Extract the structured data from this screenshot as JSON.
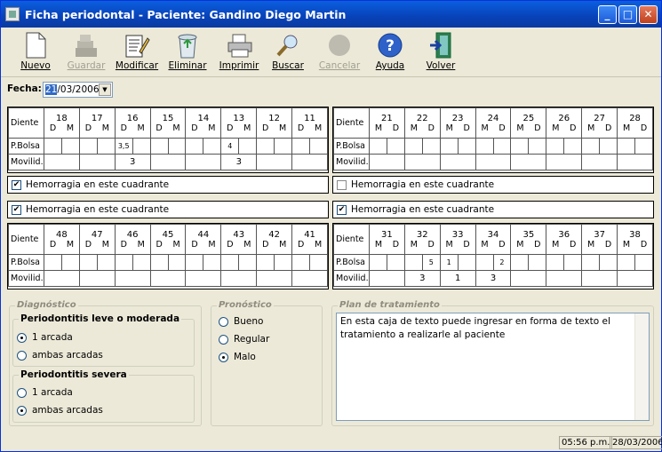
{
  "window": {
    "title": "Ficha periodontal - Paciente: Gandino Diego Martin"
  },
  "toolbar": [
    {
      "label": "Nuevo",
      "icon": "new-document-icon",
      "enabled": true
    },
    {
      "label": "Guardar",
      "icon": "save-icon",
      "enabled": false
    },
    {
      "label": "Modificar",
      "icon": "edit-document-icon",
      "enabled": true
    },
    {
      "label": "Eliminar",
      "icon": "recycle-bin-icon",
      "enabled": true
    },
    {
      "label": "Imprimir",
      "icon": "printer-icon",
      "enabled": true
    },
    {
      "label": "Buscar",
      "icon": "magnifier-icon",
      "enabled": true
    },
    {
      "label": "Cancelar",
      "icon": "cancel-icon",
      "enabled": false
    },
    {
      "label": "Ayuda",
      "icon": "help-icon",
      "enabled": true
    },
    {
      "label": "Volver",
      "icon": "exit-door-icon",
      "enabled": true
    }
  ],
  "fecha": {
    "label": "Fecha:",
    "value_sel": "21",
    "value_rest": "/03/2006"
  },
  "charts": {
    "q1": {
      "teeth": [
        "18",
        "17",
        "16",
        "15",
        "14",
        "13",
        "12",
        "11"
      ],
      "sides": [
        "D",
        "M"
      ],
      "pbolsa": [
        "",
        "",
        "",
        "",
        "3,5",
        "",
        "",
        "",
        "",
        "",
        "4",
        "",
        "",
        "",
        "",
        ""
      ],
      "movilid": [
        "",
        "",
        "3",
        "",
        "",
        "3",
        "",
        ""
      ],
      "hemorragia": true
    },
    "q2": {
      "teeth": [
        "21",
        "22",
        "23",
        "24",
        "25",
        "26",
        "27",
        "28"
      ],
      "sides": [
        "M",
        "D"
      ],
      "pbolsa": [
        "",
        "",
        "",
        "",
        "",
        "",
        "",
        "",
        "",
        "",
        "",
        "",
        "",
        "",
        "",
        ""
      ],
      "movilid": [
        "",
        "",
        "",
        "",
        "",
        "",
        "",
        ""
      ],
      "hemorragia": false
    },
    "q4": {
      "teeth": [
        "48",
        "47",
        "46",
        "45",
        "44",
        "43",
        "42",
        "41"
      ],
      "sides": [
        "D",
        "M"
      ],
      "pbolsa": [
        "",
        "",
        "",
        "",
        "",
        "",
        "",
        "",
        "",
        "",
        "",
        "",
        "",
        "",
        "",
        ""
      ],
      "movilid": [
        "",
        "",
        "",
        "",
        "",
        "",
        "",
        ""
      ],
      "hemorragia": true
    },
    "q3": {
      "teeth": [
        "31",
        "32",
        "33",
        "34",
        "35",
        "36",
        "37",
        "38"
      ],
      "sides": [
        "M",
        "D"
      ],
      "pbolsa": [
        "",
        "",
        "",
        "5",
        "1",
        "",
        "",
        "2",
        "",
        "",
        "",
        "",
        "",
        "",
        "",
        ""
      ],
      "movilid": [
        "",
        "3",
        "1",
        "3",
        "",
        "",
        "",
        ""
      ],
      "hemorragia": true
    }
  },
  "labels": {
    "diente": "Diente",
    "pbolsa": "P.Bolsa",
    "movilid": "Movilid.",
    "hemorragia": "Hemorragia en este cuadrante"
  },
  "diagnostico": {
    "title": "Diagnóstico",
    "leve": {
      "title": "Periodontitis leve o moderada",
      "options": [
        "1 arcada",
        "ambas arcadas"
      ],
      "selected": 0
    },
    "severa": {
      "title": "Periodontitis severa",
      "options": [
        "1 arcada",
        "ambas arcadas"
      ],
      "selected": 1
    }
  },
  "pronostico": {
    "title": "Pronóstico",
    "options": [
      "Bueno",
      "Regular",
      "Malo"
    ],
    "selected": 2
  },
  "plan": {
    "title": "Plan de tratamiento",
    "text": "En esta caja de texto puede ingresar en forma de texto el tratamiento a realizarle al paciente"
  },
  "status": {
    "time": "05:56 p.m.",
    "date": "28/03/2006"
  }
}
